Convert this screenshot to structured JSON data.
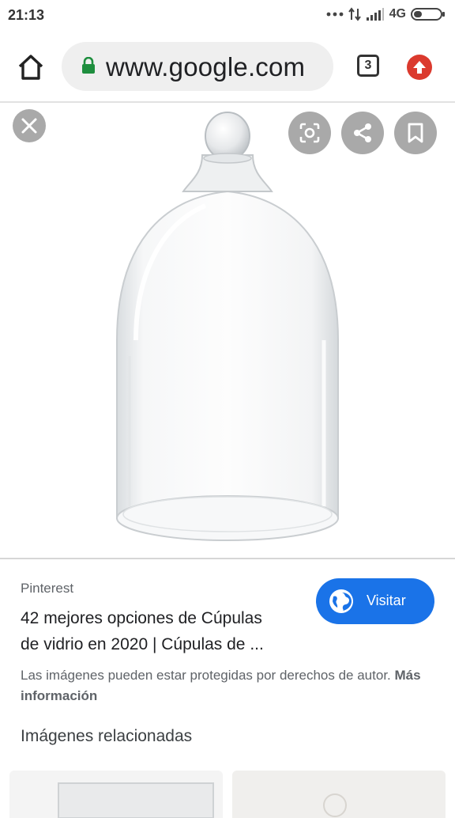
{
  "status_bar": {
    "time": "21:13",
    "network": "4G",
    "icons": [
      "more-dots-icon",
      "data-transfer-icon",
      "signal-icon",
      "battery-icon"
    ]
  },
  "browser": {
    "url": "www.google.com",
    "tab_count": "3",
    "icons": [
      "home-icon",
      "lock-icon",
      "tabs-icon",
      "update-icon"
    ],
    "colors": {
      "lock": "#1e8e3e",
      "update": "#db3a2e"
    }
  },
  "viewer": {
    "image_subject": "glass-cloche",
    "controls": [
      "close-icon",
      "lens-icon",
      "share-icon",
      "bookmark-icon"
    ]
  },
  "result": {
    "source": "Pinterest",
    "title_line1": "42 mejores opciones de Cúpulas",
    "title_line2": "de vidrio en 2020 | Cúpulas de ...",
    "visit_label": "Visitar",
    "visit_icon": "globe-icon",
    "copyright_text": "Las imágenes pueden estar protegidas por derechos de autor.",
    "more_info_label": "Más información",
    "colors": {
      "visit_button": "#1a73e8"
    }
  },
  "related": {
    "heading": "Imágenes relacionadas"
  }
}
